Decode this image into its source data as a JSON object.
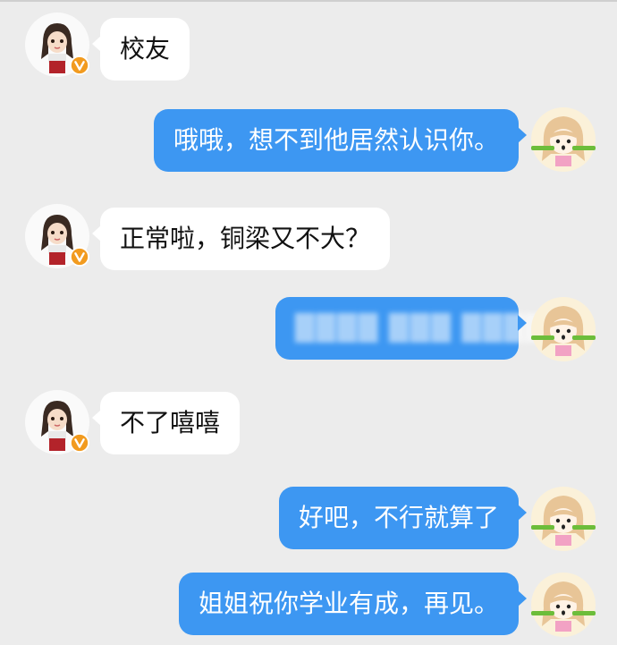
{
  "chat": {
    "messages": [
      {
        "sender": "other",
        "text": "校友"
      },
      {
        "sender": "self",
        "text": "哦哦，想不到他居然认识你。"
      },
      {
        "sender": "other",
        "text": "正常啦，铜梁又不大？"
      },
      {
        "sender": "self",
        "text": "████ ███ ████",
        "obscured": true
      },
      {
        "sender": "other",
        "text": "不了嘻嘻"
      },
      {
        "sender": "self",
        "text": "好吧，不行就算了"
      },
      {
        "sender": "self",
        "text": "姐姐祝你学业有成，再见。"
      }
    ]
  },
  "colors": {
    "background": "#ececec",
    "self_bubble": "#3d97f2",
    "other_bubble": "#ffffff",
    "verified_badge": "#f29b1f"
  },
  "icons": {
    "other_avatar": "girl-avatar-icon",
    "self_avatar": "cartoon-girl-avatar-icon",
    "badge": "verified-v-badge-icon"
  }
}
